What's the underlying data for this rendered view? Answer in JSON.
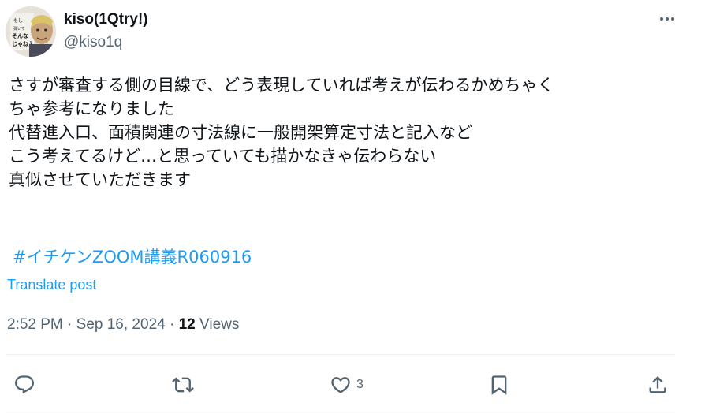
{
  "author": {
    "display_name": "kiso(1Qtry!)",
    "handle": "@kiso1q",
    "avatar_text": "もし 弾いておるならば そんなもん じゃねえ"
  },
  "post": {
    "lines": [
      "さすが審査する側の目線で、どう表現していれば考えが伝わるかめちゃく",
      "ちゃ参考になりました",
      "代替進入口、面積関連の寸法線に一般開架算定寸法と記入など",
      "こう考えてるけど…と思っていても描かなきゃ伝わらない",
      "真似させていただきます"
    ],
    "hashtag": "#イチケンZOOM講義R060916",
    "translate_label": "Translate post",
    "time": "2:52 PM",
    "date": "Sep 16, 2024",
    "views_count": "12",
    "views_label": "Views"
  },
  "actions": {
    "reply_icon": "reply-icon",
    "repost_icon": "repost-icon",
    "like_icon": "like-icon",
    "like_count": "3",
    "bookmark_icon": "bookmark-icon",
    "share_icon": "share-icon"
  },
  "colors": {
    "accent": "#1d9bf0",
    "secondary_text": "#536471",
    "primary_text": "#0f1419",
    "divider": "#eff3f4"
  }
}
